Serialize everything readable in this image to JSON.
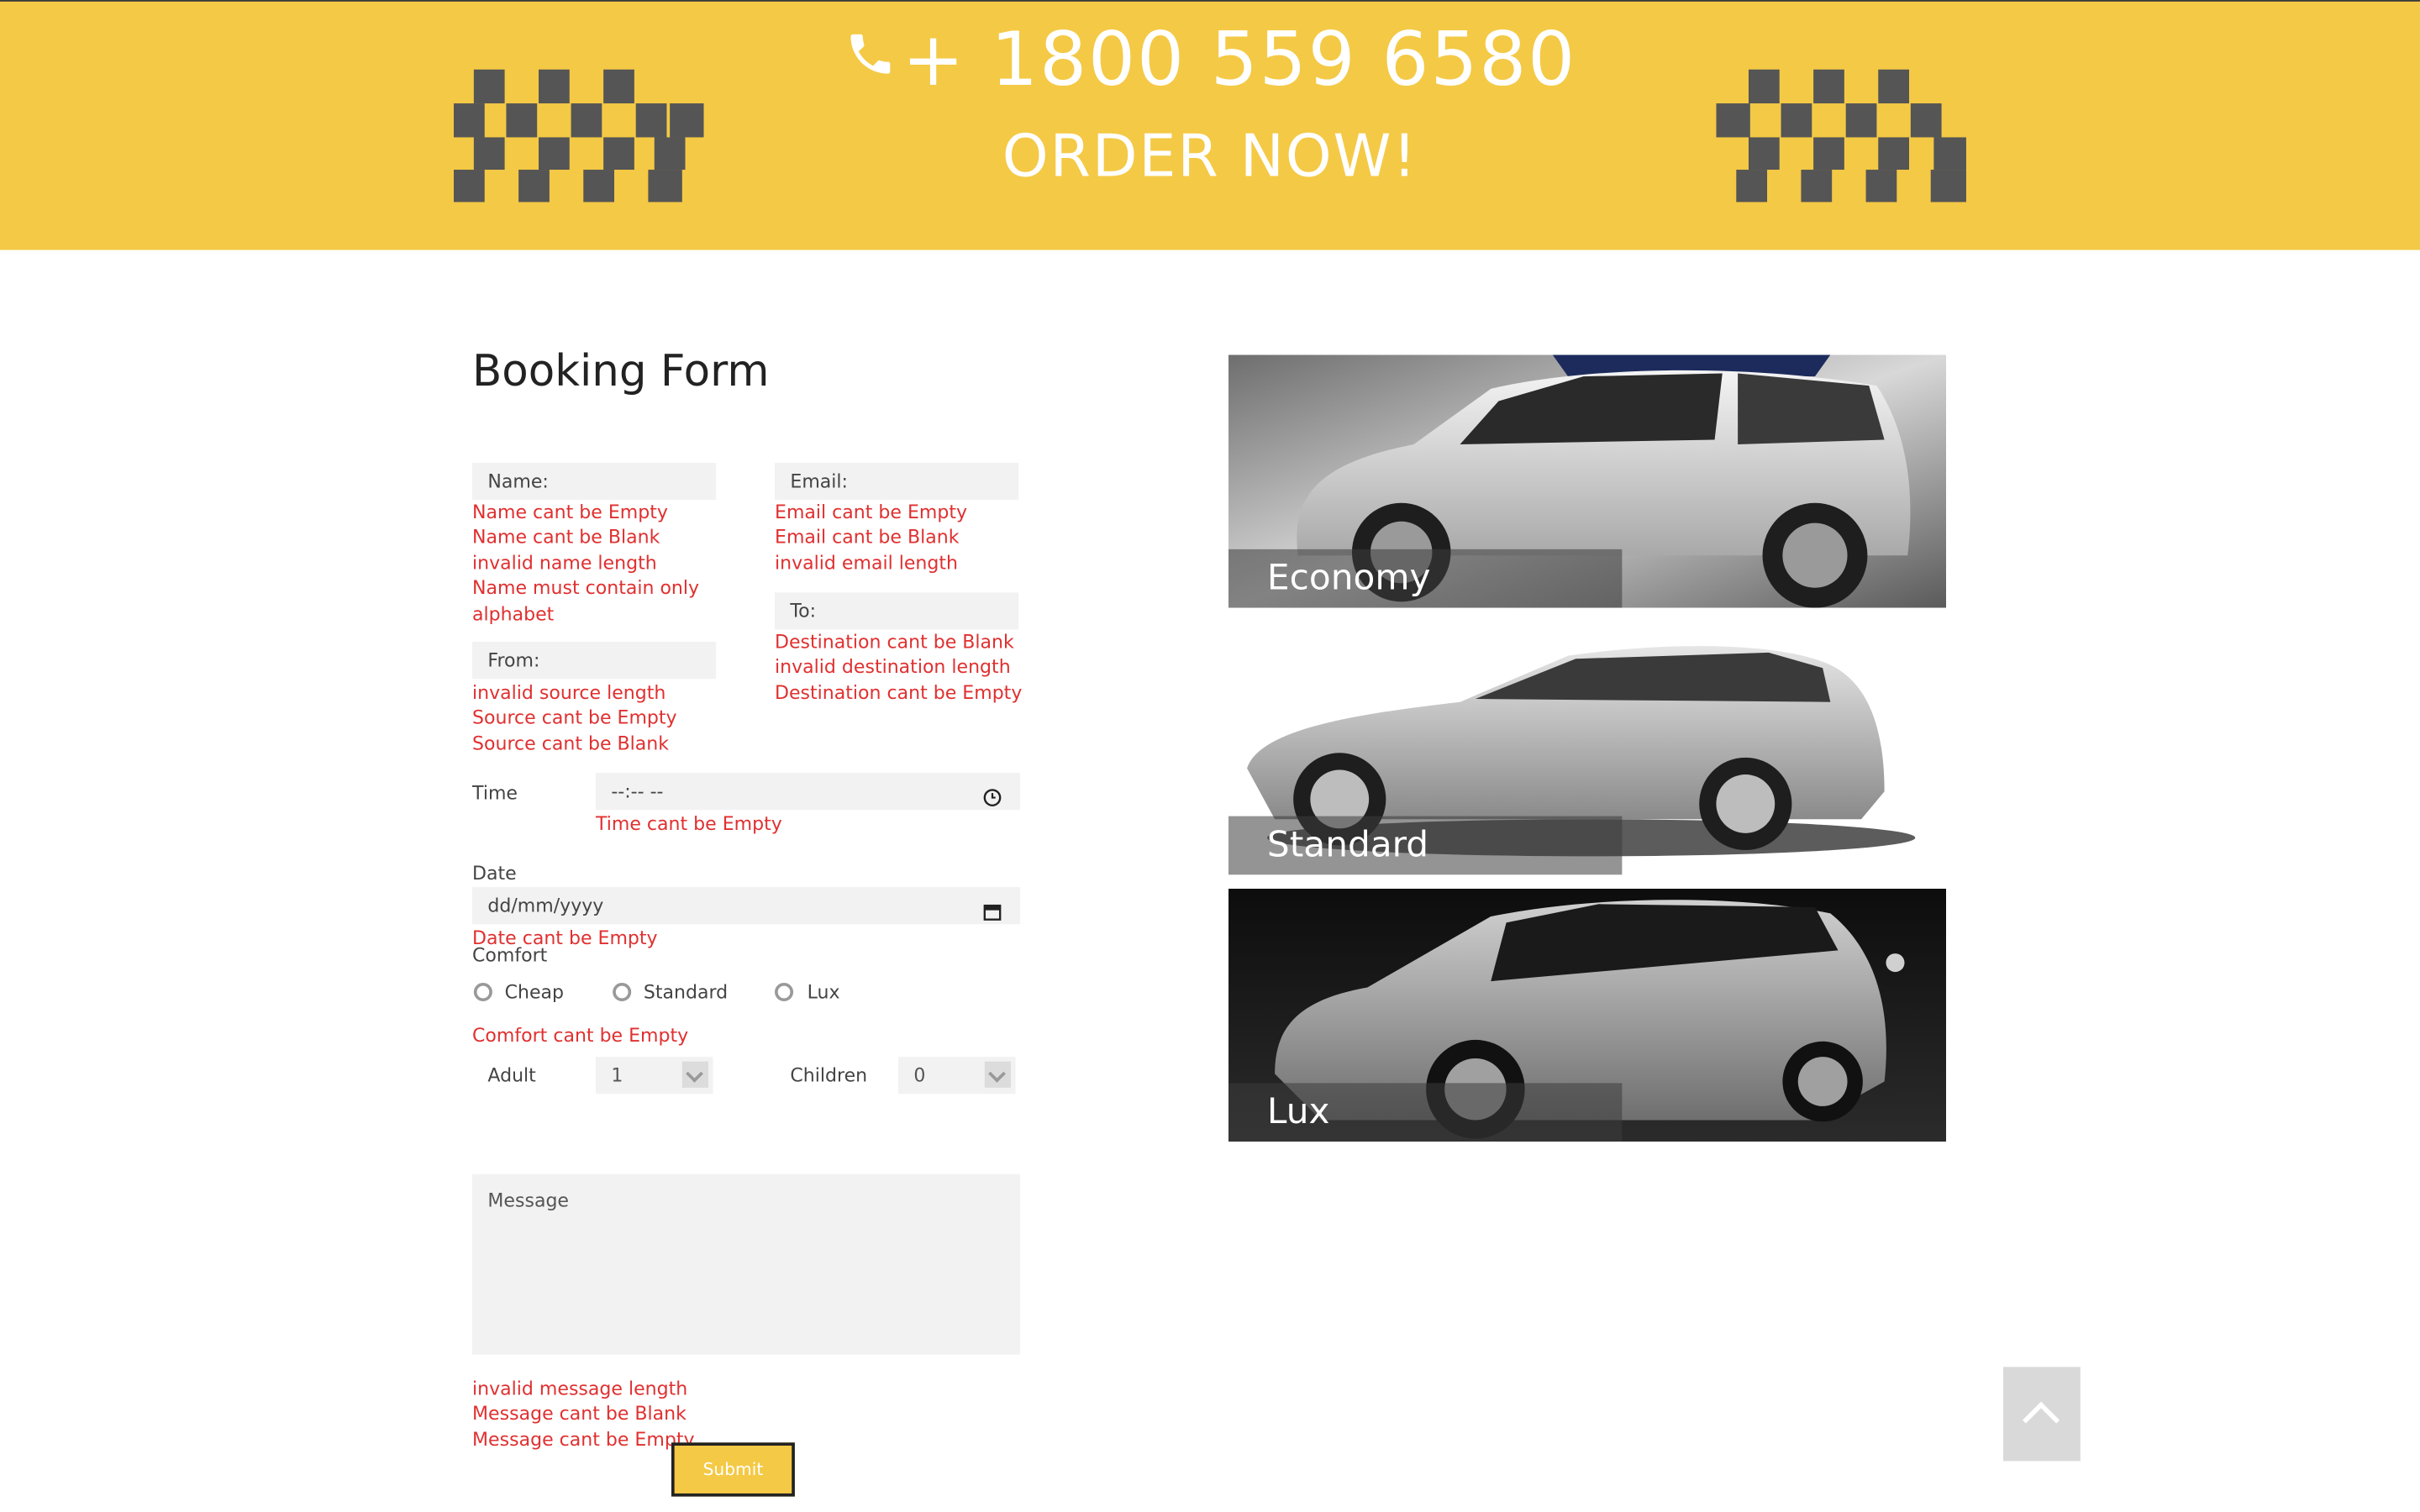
{
  "header": {
    "phone": "+ 1800 559 6580",
    "order_cta": "ORDER NOW!",
    "colors": {
      "background": "#f4c945",
      "checker": "#555555",
      "text": "#ffffff"
    }
  },
  "form": {
    "title": "Booking Form",
    "name": {
      "label": "Name:",
      "errors": [
        "Name cant be Empty",
        "Name cant be Blank",
        "invalid name length",
        "Name must contain only",
        "alphabet"
      ]
    },
    "email": {
      "label": "Email:",
      "errors": [
        "Email cant be Empty",
        "Email cant be Blank",
        "invalid email length"
      ]
    },
    "to": {
      "label": "To:",
      "errors": [
        "Destination cant be Blank",
        "invalid destination length",
        "Destination cant be Empty"
      ]
    },
    "from": {
      "label": "From:",
      "errors": [
        "invalid source length",
        "Source cant be Empty",
        "Source cant be Blank"
      ]
    },
    "time": {
      "label": "Time",
      "placeholder": "--:-- --",
      "errors": [
        "Time cant be Empty"
      ]
    },
    "date": {
      "label": "Date",
      "placeholder": "dd/mm/yyyy",
      "errors": [
        "Date cant be Empty"
      ]
    },
    "comfort": {
      "label": "Comfort",
      "options": [
        "Cheap",
        "Standard",
        "Lux"
      ],
      "errors": [
        "Comfort cant be Empty"
      ]
    },
    "adult": {
      "label": "Adult",
      "value": "1"
    },
    "children": {
      "label": "Children",
      "value": "0"
    },
    "message": {
      "placeholder": "Message",
      "errors": [
        "invalid message length",
        "Message cant be Blank",
        "Message cant be Empty"
      ]
    },
    "submit_label": "Submit",
    "error_color": "#e03030"
  },
  "cars": [
    {
      "label": "Economy",
      "icon": "hatchback-car-image"
    },
    {
      "label": "Standard",
      "icon": "wagon-car-image"
    },
    {
      "label": "Lux",
      "icon": "suv-car-image"
    }
  ],
  "scroll_top": {
    "icon": "chevron-up-icon"
  }
}
